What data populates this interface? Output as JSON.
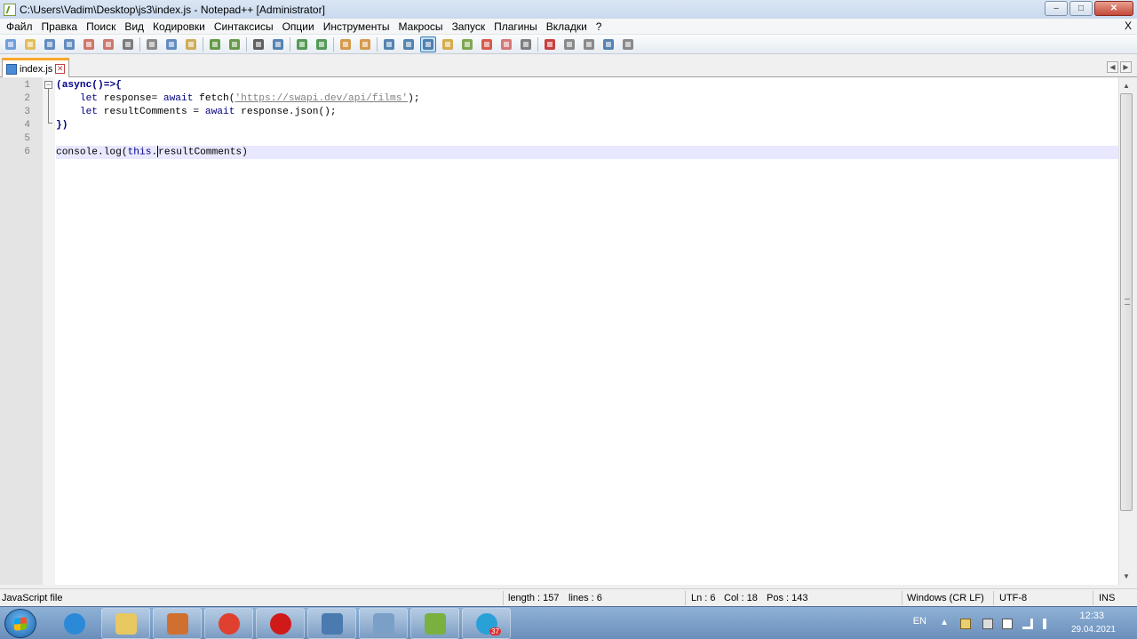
{
  "window": {
    "title": "C:\\Users\\Vadim\\Desktop\\js3\\index.js - Notepad++ [Administrator]",
    "min": "–",
    "max": "□",
    "close": "✕"
  },
  "menu": {
    "items": [
      "Файл",
      "Правка",
      "Поиск",
      "Вид",
      "Кодировки",
      "Синтаксисы",
      "Опции",
      "Инструменты",
      "Макросы",
      "Запуск",
      "Плагины",
      "Вкладки",
      "?"
    ],
    "close": "X"
  },
  "toolbar": {
    "icons": [
      "new-file-icon",
      "open-file-icon",
      "save-icon",
      "save-all-icon",
      "close-icon",
      "close-all-icon",
      "print-icon",
      "cut-icon",
      "copy-icon",
      "paste-icon",
      "undo-icon",
      "redo-icon",
      "find-icon",
      "replace-icon",
      "zoom-in-icon",
      "zoom-out-icon",
      "sync-v-icon",
      "sync-h-icon",
      "wrap-icon",
      "show-all-chars-icon",
      "indent-guide-icon",
      "udl-icon",
      "doc-map-icon",
      "function-list-icon",
      "folder-workspace-icon",
      "monitoring-icon",
      "record-macro-icon",
      "stop-macro-icon",
      "play-macro-icon",
      "run-macro-multiple-icon",
      "save-macro-icon"
    ]
  },
  "tab": {
    "label": "index.js",
    "close": "✕"
  },
  "editor": {
    "line_numbers": [
      "1",
      "2",
      "3",
      "4",
      "5",
      "6"
    ],
    "lines": [
      [
        {
          "t": "(",
          "c": "op"
        },
        {
          "t": "async",
          "c": "kw"
        },
        {
          "t": "()=>{",
          "c": "op"
        }
      ],
      [
        {
          "t": "    ",
          "c": ""
        },
        {
          "t": "let",
          "c": "kw2"
        },
        {
          "t": " response= ",
          "c": ""
        },
        {
          "t": "await",
          "c": "kw2"
        },
        {
          "t": " fetch(",
          "c": ""
        },
        {
          "t": "'https://swapi.dev/api/films'",
          "c": "str"
        },
        {
          "t": ");",
          "c": ""
        }
      ],
      [
        {
          "t": "    ",
          "c": ""
        },
        {
          "t": "let",
          "c": "kw2"
        },
        {
          "t": " resultComments = ",
          "c": ""
        },
        {
          "t": "await",
          "c": "kw2"
        },
        {
          "t": " response.json();",
          "c": ""
        }
      ],
      [
        {
          "t": "})",
          "c": "op"
        }
      ],
      [],
      [
        {
          "t": "console.log(",
          "c": ""
        },
        {
          "t": "this",
          "c": "kw2"
        },
        {
          "t": ".",
          "c": ""
        },
        {
          "t": "|",
          "c": "cursor"
        },
        {
          "t": "resultComments)",
          "c": ""
        }
      ]
    ],
    "current_line": 6
  },
  "status": {
    "filetype": "JavaScript file",
    "length": "length : 157",
    "lines": "lines : 6",
    "ln": "Ln : 6",
    "col": "Col : 18",
    "pos": "Pos : 143",
    "eol": "Windows (CR LF)",
    "encoding": "UTF-8",
    "mode": "INS"
  },
  "taskbar": {
    "apps": [
      "internet-explorer-icon",
      "file-explorer-icon",
      "media-player-icon",
      "chrome-icon",
      "opera-icon",
      "image-viewer-icon",
      "notepad-icon",
      "notepad-plus-plus-icon",
      "telegram-icon"
    ],
    "telegram_badge": "37",
    "lang": "EN",
    "time": "12:33",
    "date": "29.04.2021"
  }
}
